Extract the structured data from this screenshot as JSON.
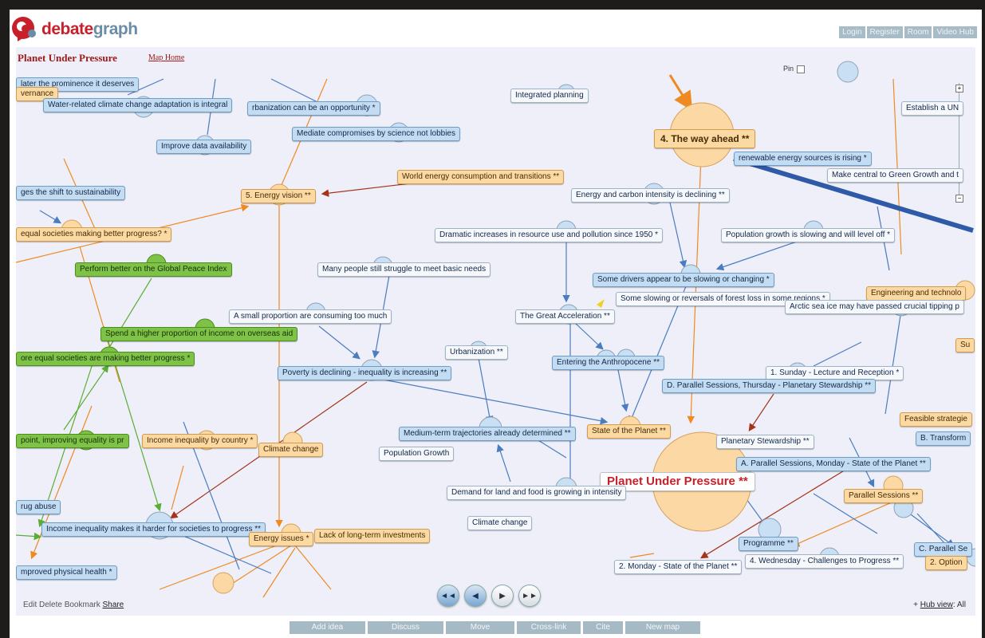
{
  "app": {
    "logo_part1": "debate",
    "logo_part2": "graph"
  },
  "top_links": [
    "Login",
    "Register",
    "Room",
    "Video Hub"
  ],
  "map": {
    "title": "Planet Under Pressure",
    "home_link": "Map Home"
  },
  "pin_label": "Pin",
  "nodes": [
    {
      "text": "later the prominence it deserves",
      "style": "blue"
    },
    {
      "text": "vernance",
      "style": "orange"
    },
    {
      "text": "Water-related climate change adaptation is integral",
      "style": "blue"
    },
    {
      "text": "rbanization can be an opportunity *",
      "style": "blue"
    },
    {
      "text": "Integrated planning",
      "style": "white"
    },
    {
      "text": "Mediate compromises by science not lobbies",
      "style": "blue"
    },
    {
      "text": "Improve data availability",
      "style": "blue"
    },
    {
      "text": "Establish a UN",
      "style": "white"
    },
    {
      "text": "4. The way ahead **",
      "style": "orange"
    },
    {
      "text": "renewable energy sources is rising *",
      "style": "blue"
    },
    {
      "text": "Make central to Green Growth and t",
      "style": "white"
    },
    {
      "text": "ges the shift to sustainability",
      "style": "blue"
    },
    {
      "text": "World energy consumption and transitions **",
      "style": "orange"
    },
    {
      "text": "5. Energy vision **",
      "style": "orange"
    },
    {
      "text": "Energy and carbon intensity is declining **",
      "style": "white"
    },
    {
      "text": "equal societies making better progress? *",
      "style": "orange"
    },
    {
      "text": "Dramatic increases in resource use and pollution since 1950 *",
      "style": "white"
    },
    {
      "text": "Population growth is slowing and will level off *",
      "style": "white"
    },
    {
      "text": "Perform better on the Global Peace Index",
      "style": "green"
    },
    {
      "text": "Many people still struggle to meet basic needs",
      "style": "white"
    },
    {
      "text": "Some drivers appear to be slowing or changing *",
      "style": "blue"
    },
    {
      "text": "Engineering and technolo",
      "style": "orange"
    },
    {
      "text": "Some slowing or reversals of forest loss in some regions *",
      "style": "white"
    },
    {
      "text": "Arctic sea ice may have passed crucial tipping p",
      "style": "white"
    },
    {
      "text": "A small proportion are consuming too much",
      "style": "white"
    },
    {
      "text": "The Great Acceleration **",
      "style": "white"
    },
    {
      "text": "Spend a higher proportion of income on overseas aid",
      "style": "green"
    },
    {
      "text": "Su",
      "style": "orange"
    },
    {
      "text": "Urbanization **",
      "style": "white"
    },
    {
      "text": "ore equal societies are making better progress *",
      "style": "green"
    },
    {
      "text": "Entering the Anthropocene **",
      "style": "blue"
    },
    {
      "text": "Poverty is declining - inequality is increasing **",
      "style": "blue"
    },
    {
      "text": "1. Sunday - Lecture and Reception *",
      "style": "white"
    },
    {
      "text": "D. Parallel Sessions, Thursday - Planetary Stewardship **",
      "style": "blue"
    },
    {
      "text": "Feasible strategie",
      "style": "orange"
    },
    {
      "text": "Medium-term trajectories already determined **",
      "style": "blue"
    },
    {
      "text": "State of the Planet **",
      "style": "orange"
    },
    {
      "text": "B. Transform",
      "style": "blue"
    },
    {
      "text": "point, improving equality is pr",
      "style": "green"
    },
    {
      "text": "Income inequality by country *",
      "style": "orange"
    },
    {
      "text": "Planetary Stewardship **",
      "style": "white"
    },
    {
      "text": "Climate change",
      "style": "orange"
    },
    {
      "text": "Population Growth",
      "style": "white"
    },
    {
      "text": "A. Parallel Sessions, Monday - State of the Planet **",
      "style": "blue"
    },
    {
      "text": "Planet Under Pressure **",
      "style": "main"
    },
    {
      "text": "Demand for land and food is growing in intensity",
      "style": "white"
    },
    {
      "text": "Parallel Sessions **",
      "style": "orange"
    },
    {
      "text": "rug abuse",
      "style": "blue"
    },
    {
      "text": "Climate change",
      "style": "white"
    },
    {
      "text": "Income inequality makes it harder for societies to progress **",
      "style": "blue"
    },
    {
      "text": "Energy issues *",
      "style": "orange"
    },
    {
      "text": "Lack of long-term investments",
      "style": "orange"
    },
    {
      "text": "Programme **",
      "style": "blue"
    },
    {
      "text": "C. Parallel Se",
      "style": "blue"
    },
    {
      "text": "4. Wednesday - Challenges to Progress **",
      "style": "white"
    },
    {
      "text": "2. Option",
      "style": "orange"
    },
    {
      "text": "mproved physical health *",
      "style": "blue"
    },
    {
      "text": "2. Monday - State of the Planet **",
      "style": "white"
    }
  ],
  "footer": {
    "edit_links": "Edit Delete Bookmark",
    "share": "Share",
    "hub_prefix": "Hub view",
    "hub_value": ": All"
  },
  "actions": [
    "Add idea",
    "Discuss",
    "Move",
    "Cross-link",
    "Cite",
    "New map"
  ],
  "icons": {
    "first": "skip-first-icon",
    "prev": "play-back-icon",
    "next": "play-forward-icon",
    "last": "skip-last-icon"
  }
}
